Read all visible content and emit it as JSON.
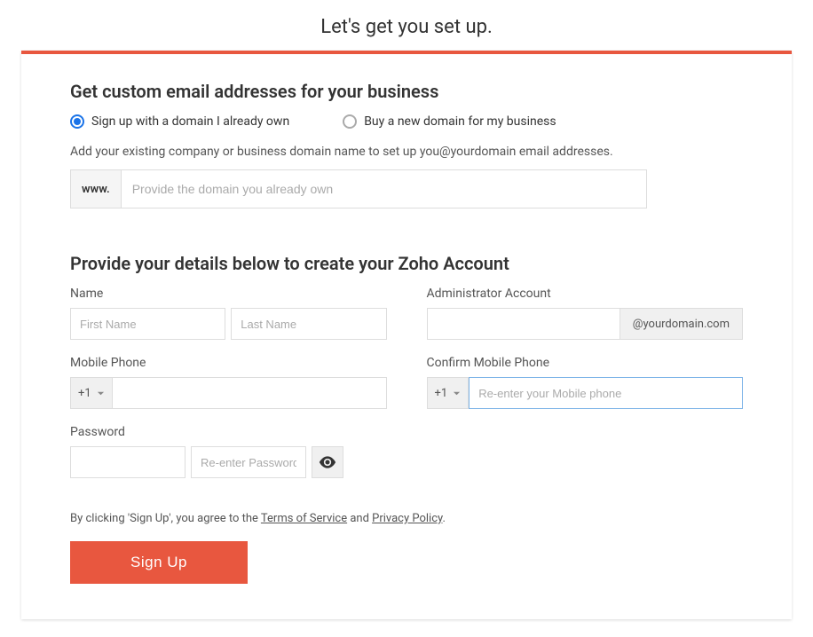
{
  "page_title": "Let's get you set up.",
  "section1": {
    "heading": "Get custom email addresses for your business",
    "option_own": "Sign up with a domain I already own",
    "option_buy": "Buy a new domain for my business",
    "help_text": "Add your existing company or business domain name to set up you@yourdomain email addresses.",
    "www_prefix": "www.",
    "domain_placeholder": "Provide the domain you already own"
  },
  "section2": {
    "heading": "Provide your details below to create your Zoho Account",
    "name_label": "Name",
    "first_name_placeholder": "First Name",
    "last_name_placeholder": "Last Name",
    "mobile_label": "Mobile Phone",
    "dial_code": "+1",
    "password_label": "Password",
    "reenter_password_placeholder": "Re-enter Password",
    "admin_label": "Administrator Account",
    "admin_suffix": "@yourdomain.com",
    "confirm_mobile_label": "Confirm Mobile Phone",
    "confirm_mobile_placeholder": "Re-enter your Mobile phone"
  },
  "terms": {
    "prefix": "By clicking 'Sign Up', you agree to the ",
    "tos": "Terms of Service",
    "mid": " and ",
    "privacy": "Privacy Policy",
    "suffix": "."
  },
  "signup_label": "Sign Up"
}
